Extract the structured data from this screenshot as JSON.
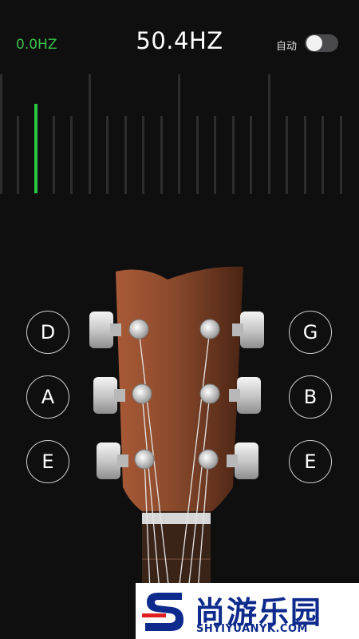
{
  "header": {
    "current_freq": "0.0HZ",
    "detected_freq": "50.4HZ",
    "auto_label": "自动",
    "auto_enabled": false
  },
  "meter": {
    "needle_color": "#27c93f"
  },
  "strings": {
    "left": [
      "D",
      "A",
      "E"
    ],
    "right": [
      "G",
      "B",
      "E"
    ]
  },
  "colors": {
    "background": "#0f0f10",
    "accent_green": "#39c24a",
    "headstock": "#8a4a2c"
  },
  "watermark": {
    "brand": "尚游乐园",
    "url": "SHYIYUANYK.COM"
  }
}
